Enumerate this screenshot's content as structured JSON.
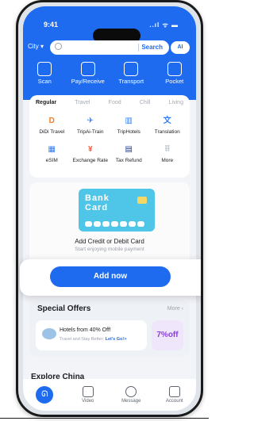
{
  "status": {
    "time": "9:41",
    "signal": "..ıl ᯤ ▬"
  },
  "search": {
    "city": "City",
    "button": "Search",
    "ai": "AI"
  },
  "quick_actions": [
    "Scan",
    "Pay/Receive",
    "Transport",
    "Pocket"
  ],
  "tabs": [
    "Regular",
    "Travel",
    "Food",
    "Chill",
    "Living"
  ],
  "services": [
    {
      "label": "DiDi Travel",
      "glyph": "D",
      "color": "#ff7a1a"
    },
    {
      "label": "TripAi-Train",
      "glyph": "✈",
      "color": "#2f7df6"
    },
    {
      "label": "TripHotels",
      "glyph": "▥",
      "color": "#2f7df6"
    },
    {
      "label": "Translation",
      "glyph": "文",
      "color": "#2f7df6"
    },
    {
      "label": "eSIM",
      "glyph": "▦",
      "color": "#2f7df6"
    },
    {
      "label": "Exchange Rate",
      "glyph": "¥",
      "color": "#ff5a3c"
    },
    {
      "label": "Tax Refund",
      "glyph": "▤",
      "color": "#1f3c88"
    },
    {
      "label": "More",
      "glyph": "⠿",
      "color": "#b7bdc8"
    }
  ],
  "bank": {
    "card_line1": "Bank",
    "card_line2": "Card",
    "title": "Add Credit or Debit Card",
    "subtitle": "Start enjoying mobile payment",
    "add_button": "Add now"
  },
  "offers": {
    "heading": "Special Offers",
    "more": "More",
    "item_title": "Hotels from 40% Off!",
    "item_sub": "Travel and Stay Better:",
    "item_link": "Let's Go!>",
    "badge": "7%off"
  },
  "explore": "Explore China",
  "tabbar": [
    "Video",
    "Message",
    "Account"
  ]
}
